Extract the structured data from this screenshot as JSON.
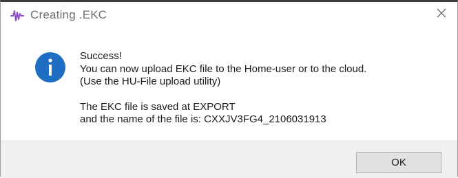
{
  "window": {
    "title": "Creating .EKC",
    "app_icon": "waveform-app-icon",
    "close_icon": "close-icon"
  },
  "message": {
    "icon": "info-icon",
    "lines": [
      "Success!",
      "You can now upload EKC file to the Home-user or to the cloud.",
      "(Use the HU-File upload utility)",
      "The EKC file is saved at EXPORT",
      "and the name of the file is: CXXJV3FG4_2106031913"
    ]
  },
  "buttons": {
    "ok_label": "OK"
  },
  "colors": {
    "info_blue": "#1E6FC4",
    "app_icon_purple": "#8A4FC8",
    "footer_gray": "#F0F0F0"
  }
}
